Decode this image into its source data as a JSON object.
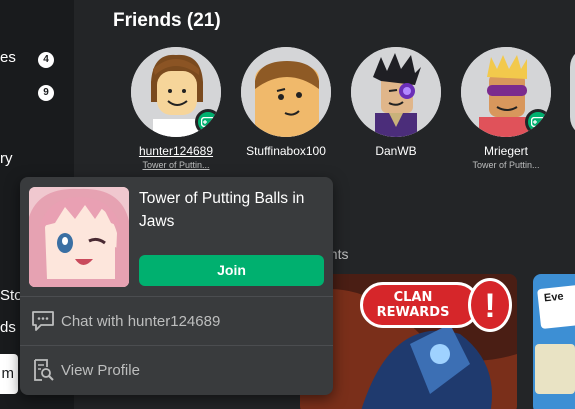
{
  "sidebar": {
    "items": [
      {
        "label": "es",
        "badge": "4"
      },
      {
        "label": "",
        "badge": "9"
      },
      {
        "label": "ry",
        "badge": ""
      },
      {
        "label": "Sto",
        "badge": ""
      },
      {
        "label": "ds",
        "badge": ""
      }
    ],
    "input_value": "m"
  },
  "friends": {
    "title": "Friends (21)",
    "list": [
      {
        "name": "hunter124689",
        "game": "Tower of Puttin...",
        "online": true
      },
      {
        "name": "Stuffinabox100",
        "game": "",
        "online": false
      },
      {
        "name": "DanWB",
        "game": "",
        "online": false
      },
      {
        "name": "Mriegert",
        "game": "Tower of Puttin...",
        "online": true
      }
    ]
  },
  "section_hint": "ghts",
  "cards": {
    "clan_line1": "CLAN",
    "clan_line2": "REWARDS",
    "clan_mark": "!",
    "partial_label": "Eve"
  },
  "popup": {
    "game_title": "Tower of Putting Balls in Jaws",
    "join_label": "Join",
    "chat_label": "Chat with hunter124689",
    "profile_label": "View Profile"
  },
  "colors": {
    "background": "#232527",
    "sidebar": "#191b1d",
    "popup": "#393b3d",
    "join": "#00b06f",
    "online_badge": "#00b06f"
  }
}
